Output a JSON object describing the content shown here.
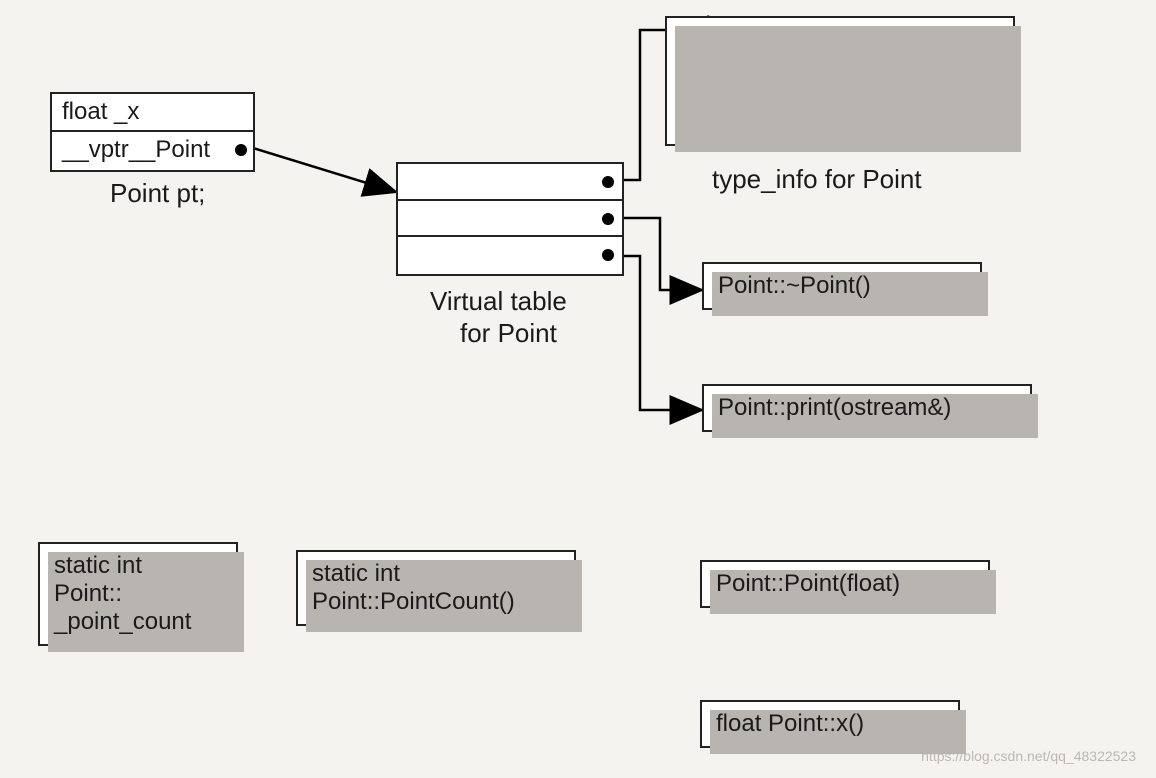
{
  "object": {
    "row1": "float _x",
    "row2": "__vptr__Point",
    "caption": "Point pt;"
  },
  "vtable": {
    "caption_line1": "Virtual table",
    "caption_line2": "for Point"
  },
  "typeinfo": {
    "caption": "type_info for Point"
  },
  "func_dtor": "Point::~Point()",
  "func_print": "Point::print(ostream&)",
  "static_var_line1": "static int",
  "static_var_line2": "Point::",
  "static_var_line3": "_point_count",
  "static_fn_line1": "static int",
  "static_fn_line2": "Point::PointCount()",
  "func_ctor": "Point::Point(float)",
  "func_x": "float Point::x()",
  "watermark": "https://blog.csdn.net/qq_48322523"
}
